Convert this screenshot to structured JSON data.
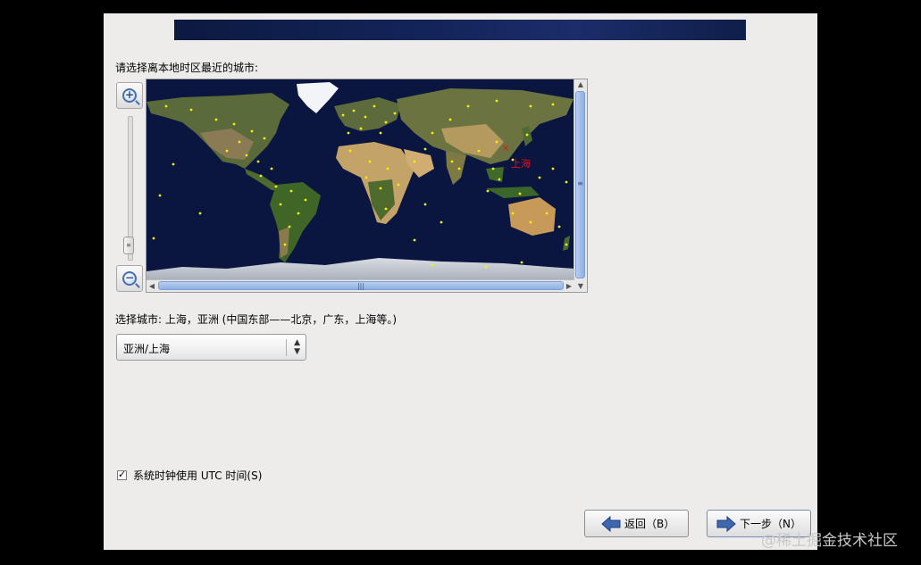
{
  "prompt_label": "请选择离本地时区最近的城市:",
  "map": {
    "selected_marker_label": "上海",
    "colors": {
      "ocean": "#0a1540",
      "city_dot": "#f5f000",
      "selected": "#e8101a"
    }
  },
  "selected_city_text": "选择城市: 上海，亚洲 (中国东部——北京，广东，上海等。)",
  "timezone_select": {
    "value": "亚洲/上海"
  },
  "utc_checkbox": {
    "label": "系统时钟使用 UTC 时间(S)",
    "checked": true
  },
  "buttons": {
    "back": "返回（B）",
    "next": "下一步（N）"
  },
  "icons": {
    "zoom_in": "zoom-in-icon",
    "zoom_out": "zoom-out-icon",
    "back": "arrow-left-icon",
    "next": "arrow-right-icon"
  },
  "watermark": "@稀土掘金技术社区"
}
